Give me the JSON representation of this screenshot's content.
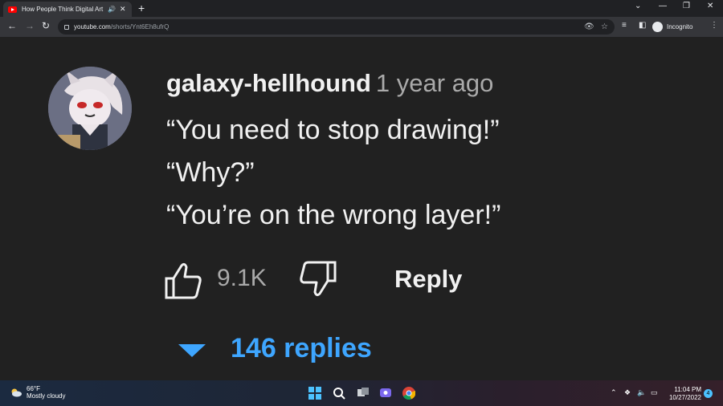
{
  "browser": {
    "tab_title": "How People Think Digital Art Is Made",
    "url_host": "youtube.com",
    "url_path": "/shorts/Ynt6Eh8ufrQ",
    "profile_label": "Incognito"
  },
  "comment": {
    "author": "galaxy-hellhound",
    "time_ago": "1 year ago",
    "lines": [
      "“You need to stop drawing!”",
      "“Why?”",
      "“You’re on the wrong layer!”"
    ],
    "like_count": "9.1K",
    "reply_label": "Reply",
    "replies_label": "146 replies"
  },
  "taskbar": {
    "temperature": "66°F",
    "weather": "Mostly cloudy",
    "time": "11:04 PM",
    "date": "10/27/2022",
    "notification_count": "4"
  },
  "colors": {
    "background": "#212121",
    "text_primary": "#f1f1f1",
    "text_secondary": "#aaaaaa",
    "link_blue": "#3ea6ff"
  }
}
